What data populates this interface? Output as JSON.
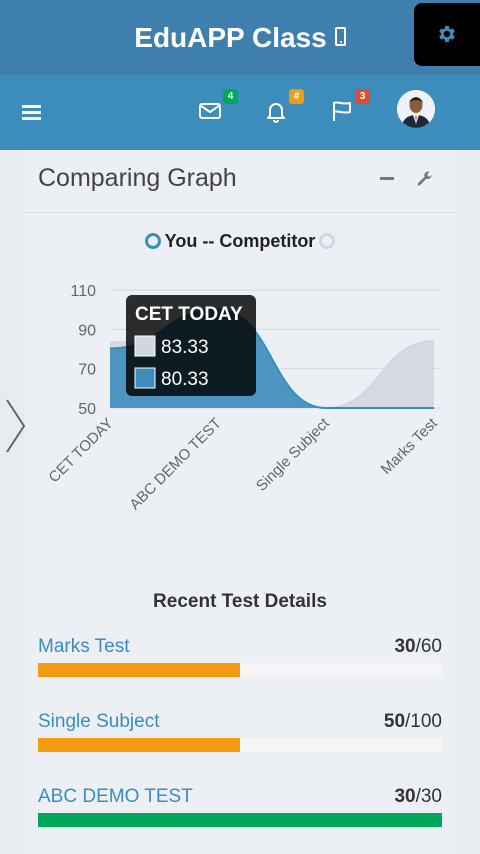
{
  "header": {
    "app_title": "EduAPP Class",
    "brand_color": "#3f7fad"
  },
  "navbar": {
    "color": "#3c8dbc",
    "messages": {
      "icon": "envelope-icon",
      "count": "4",
      "badge_color": "#00a65a"
    },
    "notifications": {
      "icon": "bell-icon",
      "count": "#",
      "badge_color": "#f39c12"
    },
    "flags": {
      "icon": "flag-icon",
      "count": "3",
      "badge_color": "#dd4b39"
    }
  },
  "panel": {
    "title": "Comparing Graph",
    "legend": "You -- Competitor"
  },
  "chart_data": {
    "type": "area",
    "categories": [
      "CET TODAY",
      "ABC DEMO TEST",
      "Single Subject",
      "Marks Test"
    ],
    "series": [
      {
        "name": "You",
        "color": "#3c8dbc",
        "values": [
          80.33,
          100,
          50,
          50
        ]
      },
      {
        "name": "Competitor",
        "color": "#d2d6de",
        "values": [
          83.33,
          88,
          50,
          84
        ]
      }
    ],
    "yticks": [
      "110",
      "90",
      "70",
      "50"
    ],
    "ylim": [
      50,
      110
    ],
    "tooltip": {
      "title": "CET TODAY",
      "rows": [
        {
          "value": "83.33",
          "swatch": "#d2d6de"
        },
        {
          "value": "80.33",
          "swatch": "#3c8dbc"
        }
      ]
    }
  },
  "recent": {
    "title": "Recent Test Details",
    "tests": [
      {
        "name": "Marks Test",
        "score": "30",
        "total": "/60",
        "progress": 0.5,
        "color": "#f39c12"
      },
      {
        "name": "Single Subject",
        "score": "50",
        "total": "/100",
        "progress": 0.5,
        "color": "#f39c12"
      },
      {
        "name": "ABC DEMO TEST",
        "score": "30",
        "total": "/30",
        "progress": 1.0,
        "color": "#00a65a"
      }
    ]
  }
}
